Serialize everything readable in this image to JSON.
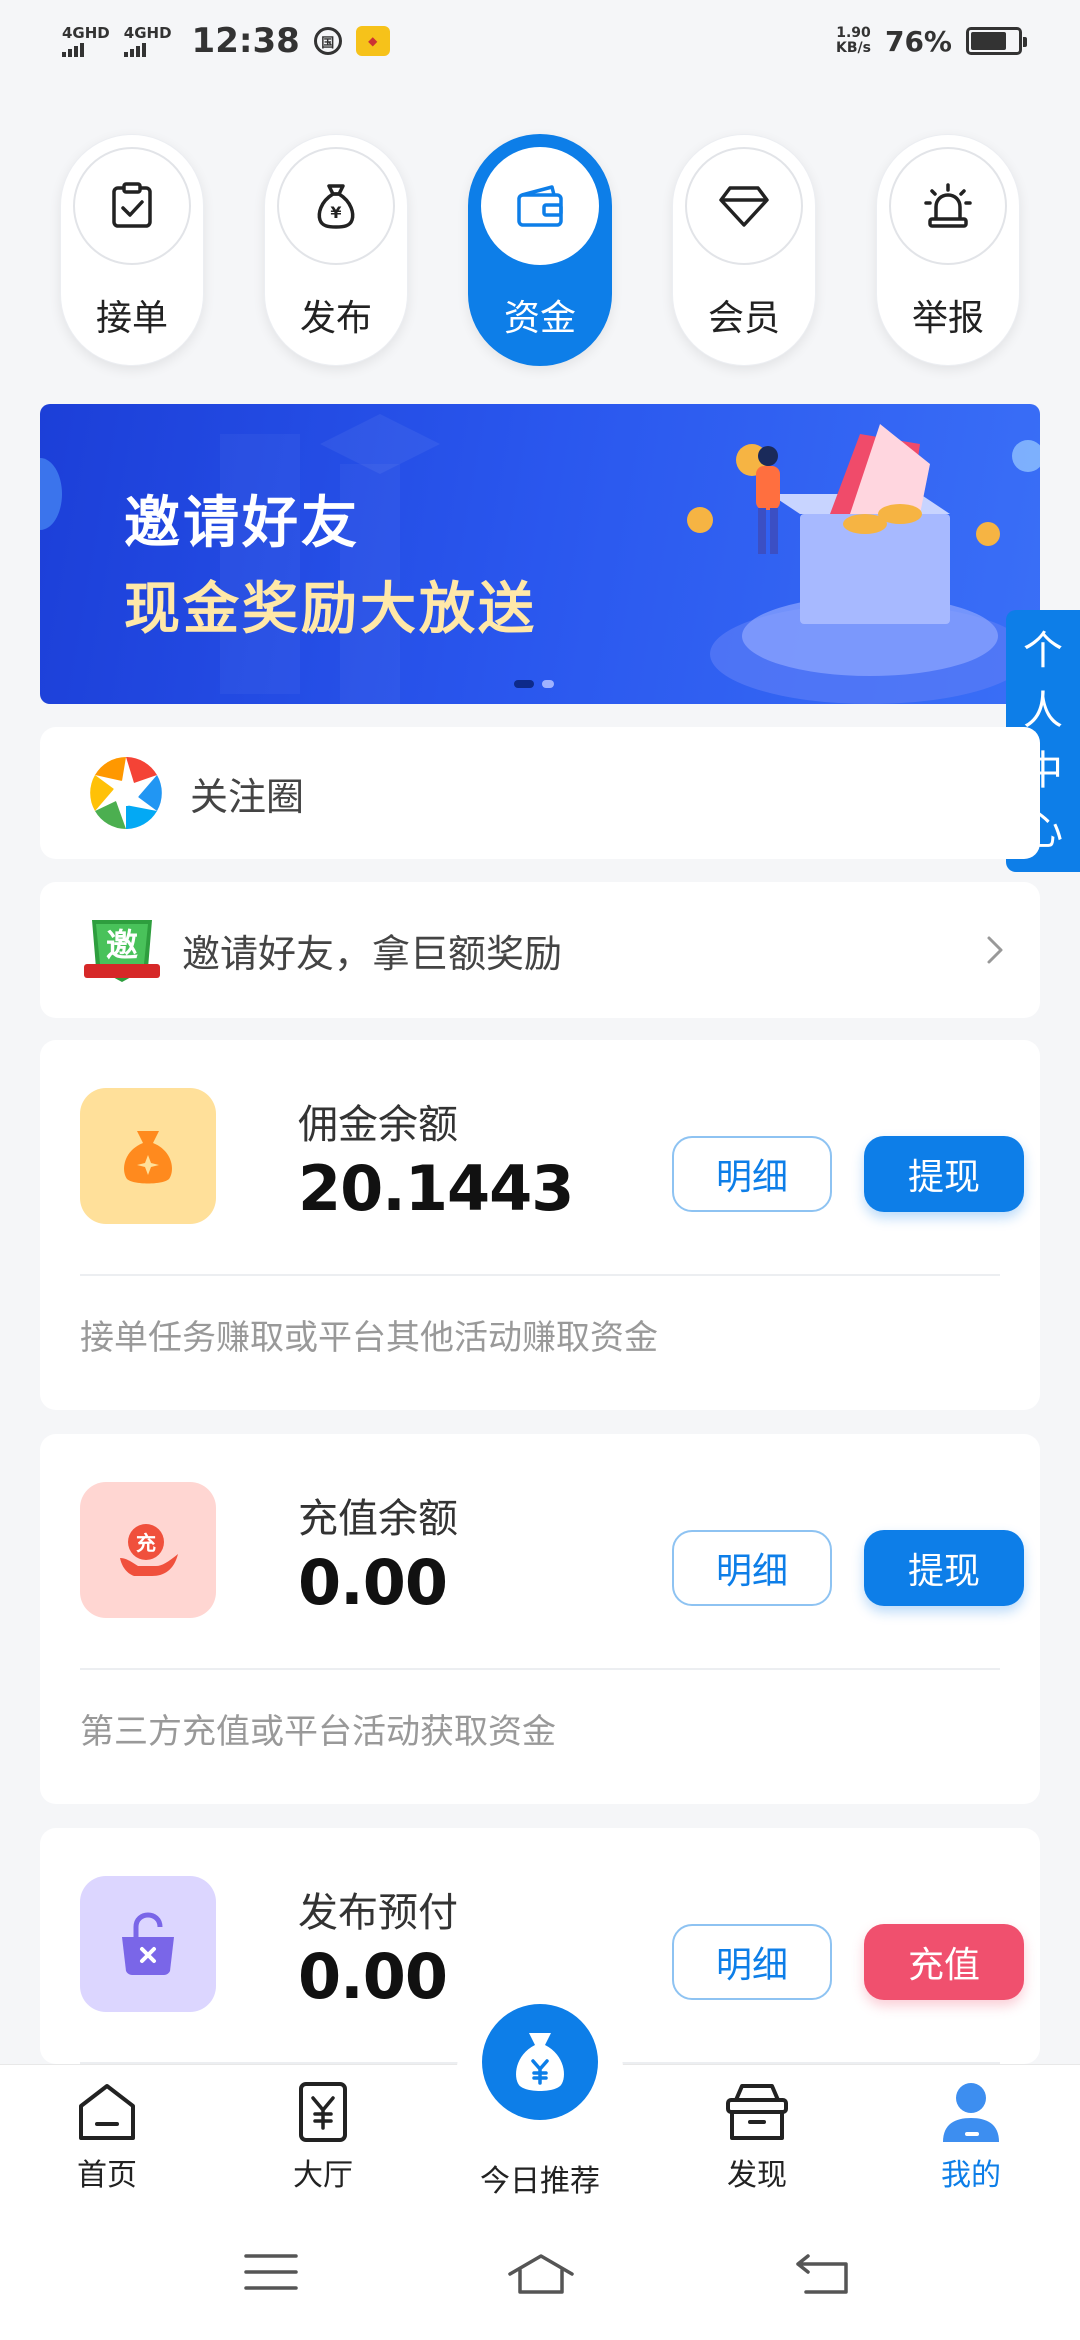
{
  "status_bar": {
    "network1": "4GHD",
    "network2": "4GHD",
    "time": "12:38",
    "speed_value": "1.90",
    "speed_unit": "KB/s",
    "battery": "76%"
  },
  "top_nav": [
    {
      "label": "接单",
      "icon": "clipboard-check-icon"
    },
    {
      "label": "发布",
      "icon": "money-bag-icon"
    },
    {
      "label": "资金",
      "icon": "wallet-icon",
      "active": true
    },
    {
      "label": "会员",
      "icon": "diamond-icon"
    },
    {
      "label": "举报",
      "icon": "alarm-icon"
    }
  ],
  "banner": {
    "line1": "邀请好友",
    "line2": "现金奖励大放送",
    "slide_count": 2,
    "active_slide": 1
  },
  "side_tab": {
    "chars": [
      "个",
      "人",
      "中",
      "心"
    ]
  },
  "follow": {
    "label": "关注圈"
  },
  "invite": {
    "label": "邀请好友，拿巨额奖励",
    "badge": "邀"
  },
  "funds": [
    {
      "title": "佣金余额",
      "amount": "20.1443",
      "detail": "明细",
      "action": "提现",
      "desc": "接单任务赚取或平台其他活动赚取资金",
      "icon_bg": "#ffe09a",
      "icon_fg": "#ff8a1e"
    },
    {
      "title": "充值余额",
      "amount": "0.00",
      "detail": "明细",
      "action": "提现",
      "desc": "第三方充值或平台活动获取资金",
      "icon_bg": "#ffd6d2",
      "icon_fg": "#f0503c",
      "icon_text": "充"
    },
    {
      "title": "发布预付",
      "amount": "0.00",
      "detail": "明细",
      "action": "充值",
      "desc": "",
      "icon_bg": "#dcd6ff",
      "icon_fg": "#7a66e8"
    }
  ],
  "bottom_nav": {
    "home": "首页",
    "hall": "大厅",
    "today": "今日推荐",
    "discover": "发现",
    "mine": "我的"
  },
  "colors": {
    "primary": "#0d7ee8",
    "accent_red": "#f0506e"
  }
}
